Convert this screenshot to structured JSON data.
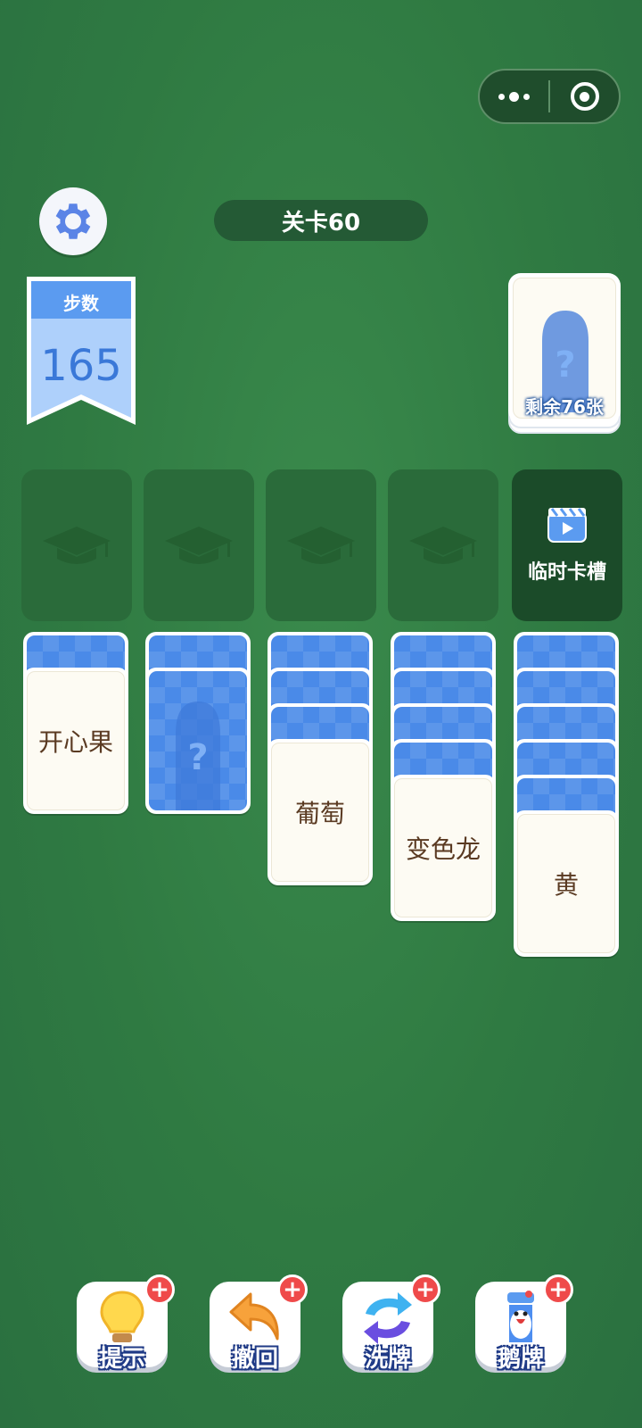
{
  "header": {
    "level_title": "关卡60"
  },
  "steps": {
    "label": "步数",
    "value": "165"
  },
  "draw_pile": {
    "remaining_label": "剩余76张"
  },
  "slots": {
    "temp_slot_label": "临时卡槽",
    "empty_slot_icon": "graduation-cap-icon"
  },
  "columns": [
    {
      "face_up": "开心果",
      "hidden_cards": 1
    },
    {
      "face_up": "",
      "hidden_cards": 1,
      "top_is_back": true
    },
    {
      "face_up": "葡萄",
      "hidden_cards": 3
    },
    {
      "face_up": "变色龙",
      "hidden_cards": 4
    },
    {
      "face_up": "黄",
      "hidden_cards": 5
    }
  ],
  "tools": {
    "hint": "提示",
    "undo": "撤回",
    "shuffle": "洗牌",
    "goose": "鹅牌",
    "plus": "+"
  },
  "colors": {
    "background": "#2f7a42",
    "card_back": "#4a8ae8",
    "card_text": "#5a3a22",
    "plus_badge": "#ef4a4a"
  }
}
